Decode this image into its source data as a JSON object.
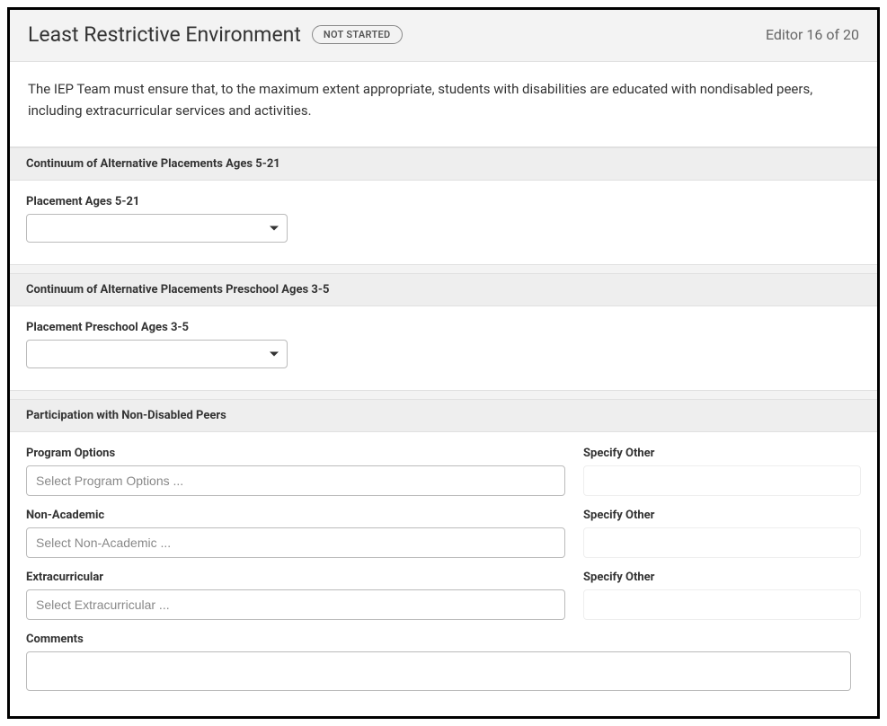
{
  "header": {
    "title": "Least Restrictive Environment",
    "status": "NOT STARTED",
    "editor_count": "Editor 16 of 20"
  },
  "intro": "The IEP Team must ensure that, to the maximum extent appropriate, students with disabilities are educated with nondisabled peers, including extracurricular services and activities.",
  "sections": {
    "cap_5_21": {
      "header": "Continuum of Alternative Placements Ages 5-21",
      "placement_label": "Placement Ages 5-21",
      "placement_value": ""
    },
    "cap_3_5": {
      "header": "Continuum of Alternative Placements Preschool Ages 3-5",
      "placement_label": "Placement Preschool Ages 3-5",
      "placement_value": ""
    },
    "participation": {
      "header": "Participation with Non-Disabled Peers",
      "program_options_label": "Program Options",
      "program_options_placeholder": "Select Program Options ...",
      "program_options_specify_label": "Specify Other",
      "non_academic_label": "Non-Academic",
      "non_academic_placeholder": "Select Non-Academic ...",
      "non_academic_specify_label": "Specify Other",
      "extracurricular_label": "Extracurricular",
      "extracurricular_placeholder": "Select Extracurricular ...",
      "extracurricular_specify_label": "Specify Other",
      "comments_label": "Comments",
      "comments_value": ""
    }
  }
}
